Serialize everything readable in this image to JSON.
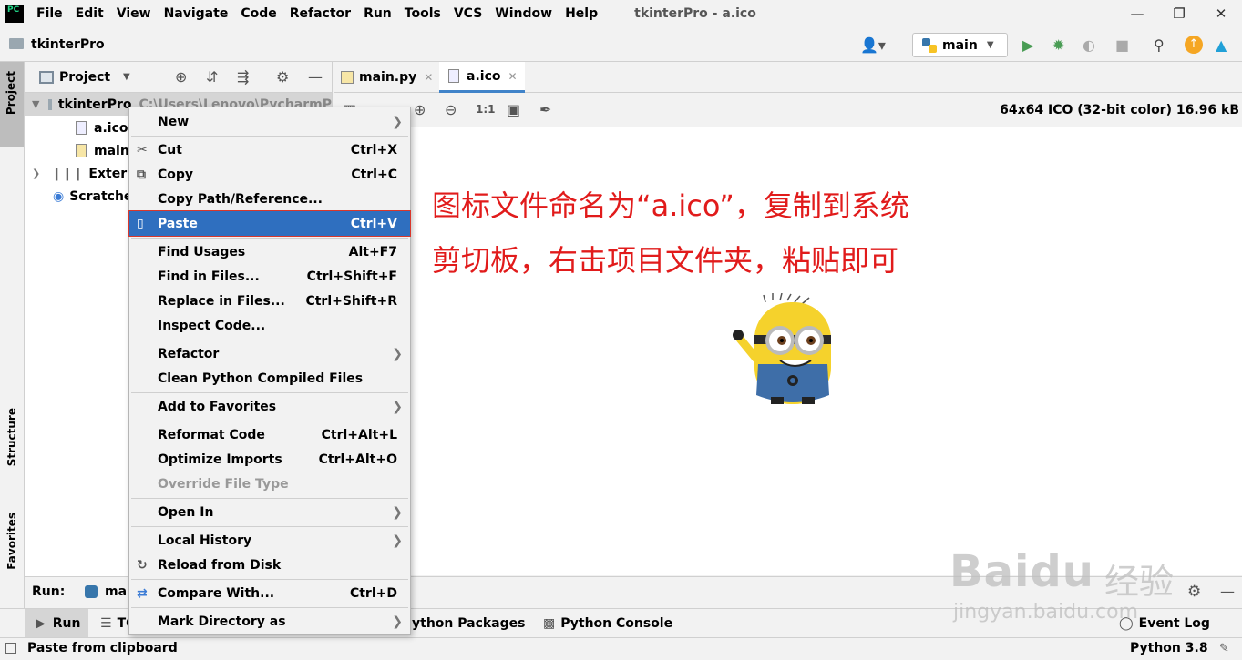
{
  "app": {
    "logo_text": "PC",
    "window_title": "tkinterPro - a.ico",
    "menu": [
      "File",
      "Edit",
      "View",
      "Navigate",
      "Code",
      "Refactor",
      "Run",
      "Tools",
      "VCS",
      "Window",
      "Help"
    ]
  },
  "navbar": {
    "project_name": "tkinterPro",
    "run_config": "main"
  },
  "left_stripe": {
    "project": "Project",
    "structure": "Structure",
    "favorites": "Favorites"
  },
  "project_panel": {
    "title": "Project",
    "root_name": "tkinterPro",
    "root_path": "C:\\Users\\Lenovo\\PycharmP",
    "files": [
      "a.ico",
      "main"
    ],
    "external": "External",
    "scratches": "Scratche"
  },
  "editor": {
    "tabs": [
      {
        "label": "main.py"
      },
      {
        "label": "a.ico"
      }
    ],
    "zoom_actual": "1:1",
    "image_info": "64x64 ICO (32-bit color) 16.96 kB",
    "annotation_line1": "图标文件命名为“a.ico”，复制到系统",
    "annotation_line2": "剪切板，右击项目文件夹，粘贴即可"
  },
  "context_menu": {
    "items": [
      {
        "label": "New",
        "shortcut": "",
        "submenu": true
      },
      {
        "label": "Cut",
        "shortcut": "Ctrl+X"
      },
      {
        "label": "Copy",
        "shortcut": "Ctrl+C"
      },
      {
        "label": "Copy Path/Reference...",
        "shortcut": ""
      },
      {
        "label": "Paste",
        "shortcut": "Ctrl+V"
      },
      {
        "label": "Find Usages",
        "shortcut": "Alt+F7"
      },
      {
        "label": "Find in Files...",
        "shortcut": "Ctrl+Shift+F"
      },
      {
        "label": "Replace in Files...",
        "shortcut": "Ctrl+Shift+R"
      },
      {
        "label": "Inspect Code...",
        "shortcut": ""
      },
      {
        "label": "Refactor",
        "shortcut": "",
        "submenu": true
      },
      {
        "label": "Clean Python Compiled Files",
        "shortcut": ""
      },
      {
        "label": "Add to Favorites",
        "shortcut": "",
        "submenu": true
      },
      {
        "label": "Reformat Code",
        "shortcut": "Ctrl+Alt+L"
      },
      {
        "label": "Optimize Imports",
        "shortcut": "Ctrl+Alt+O"
      },
      {
        "label": "Override File Type",
        "shortcut": "",
        "disabled": true
      },
      {
        "label": "Open In",
        "shortcut": "",
        "submenu": true
      },
      {
        "label": "Local History",
        "shortcut": "",
        "submenu": true
      },
      {
        "label": "Reload from Disk",
        "shortcut": ""
      },
      {
        "label": "Compare With...",
        "shortcut": "Ctrl+D"
      },
      {
        "label": "Mark Directory as",
        "shortcut": "",
        "submenu": true
      }
    ]
  },
  "run_panel": {
    "label": "Run:",
    "config": "mai"
  },
  "bottom_tabs": {
    "run": "Run",
    "todo": "TO",
    "python_packages": "ython Packages",
    "python_console": "Python Console",
    "event_log": "Event Log"
  },
  "status": {
    "message": "Paste from clipboard",
    "interpreter": "Python 3.8"
  },
  "watermark": {
    "brand": "Baidu",
    "cn": "经验",
    "url": "jingyan.baidu.com"
  },
  "colors": {
    "selection": "#2f6fbf",
    "highlight_border": "#d9372b",
    "annotation": "#e11b1b",
    "tab_underline": "#4083c9"
  }
}
